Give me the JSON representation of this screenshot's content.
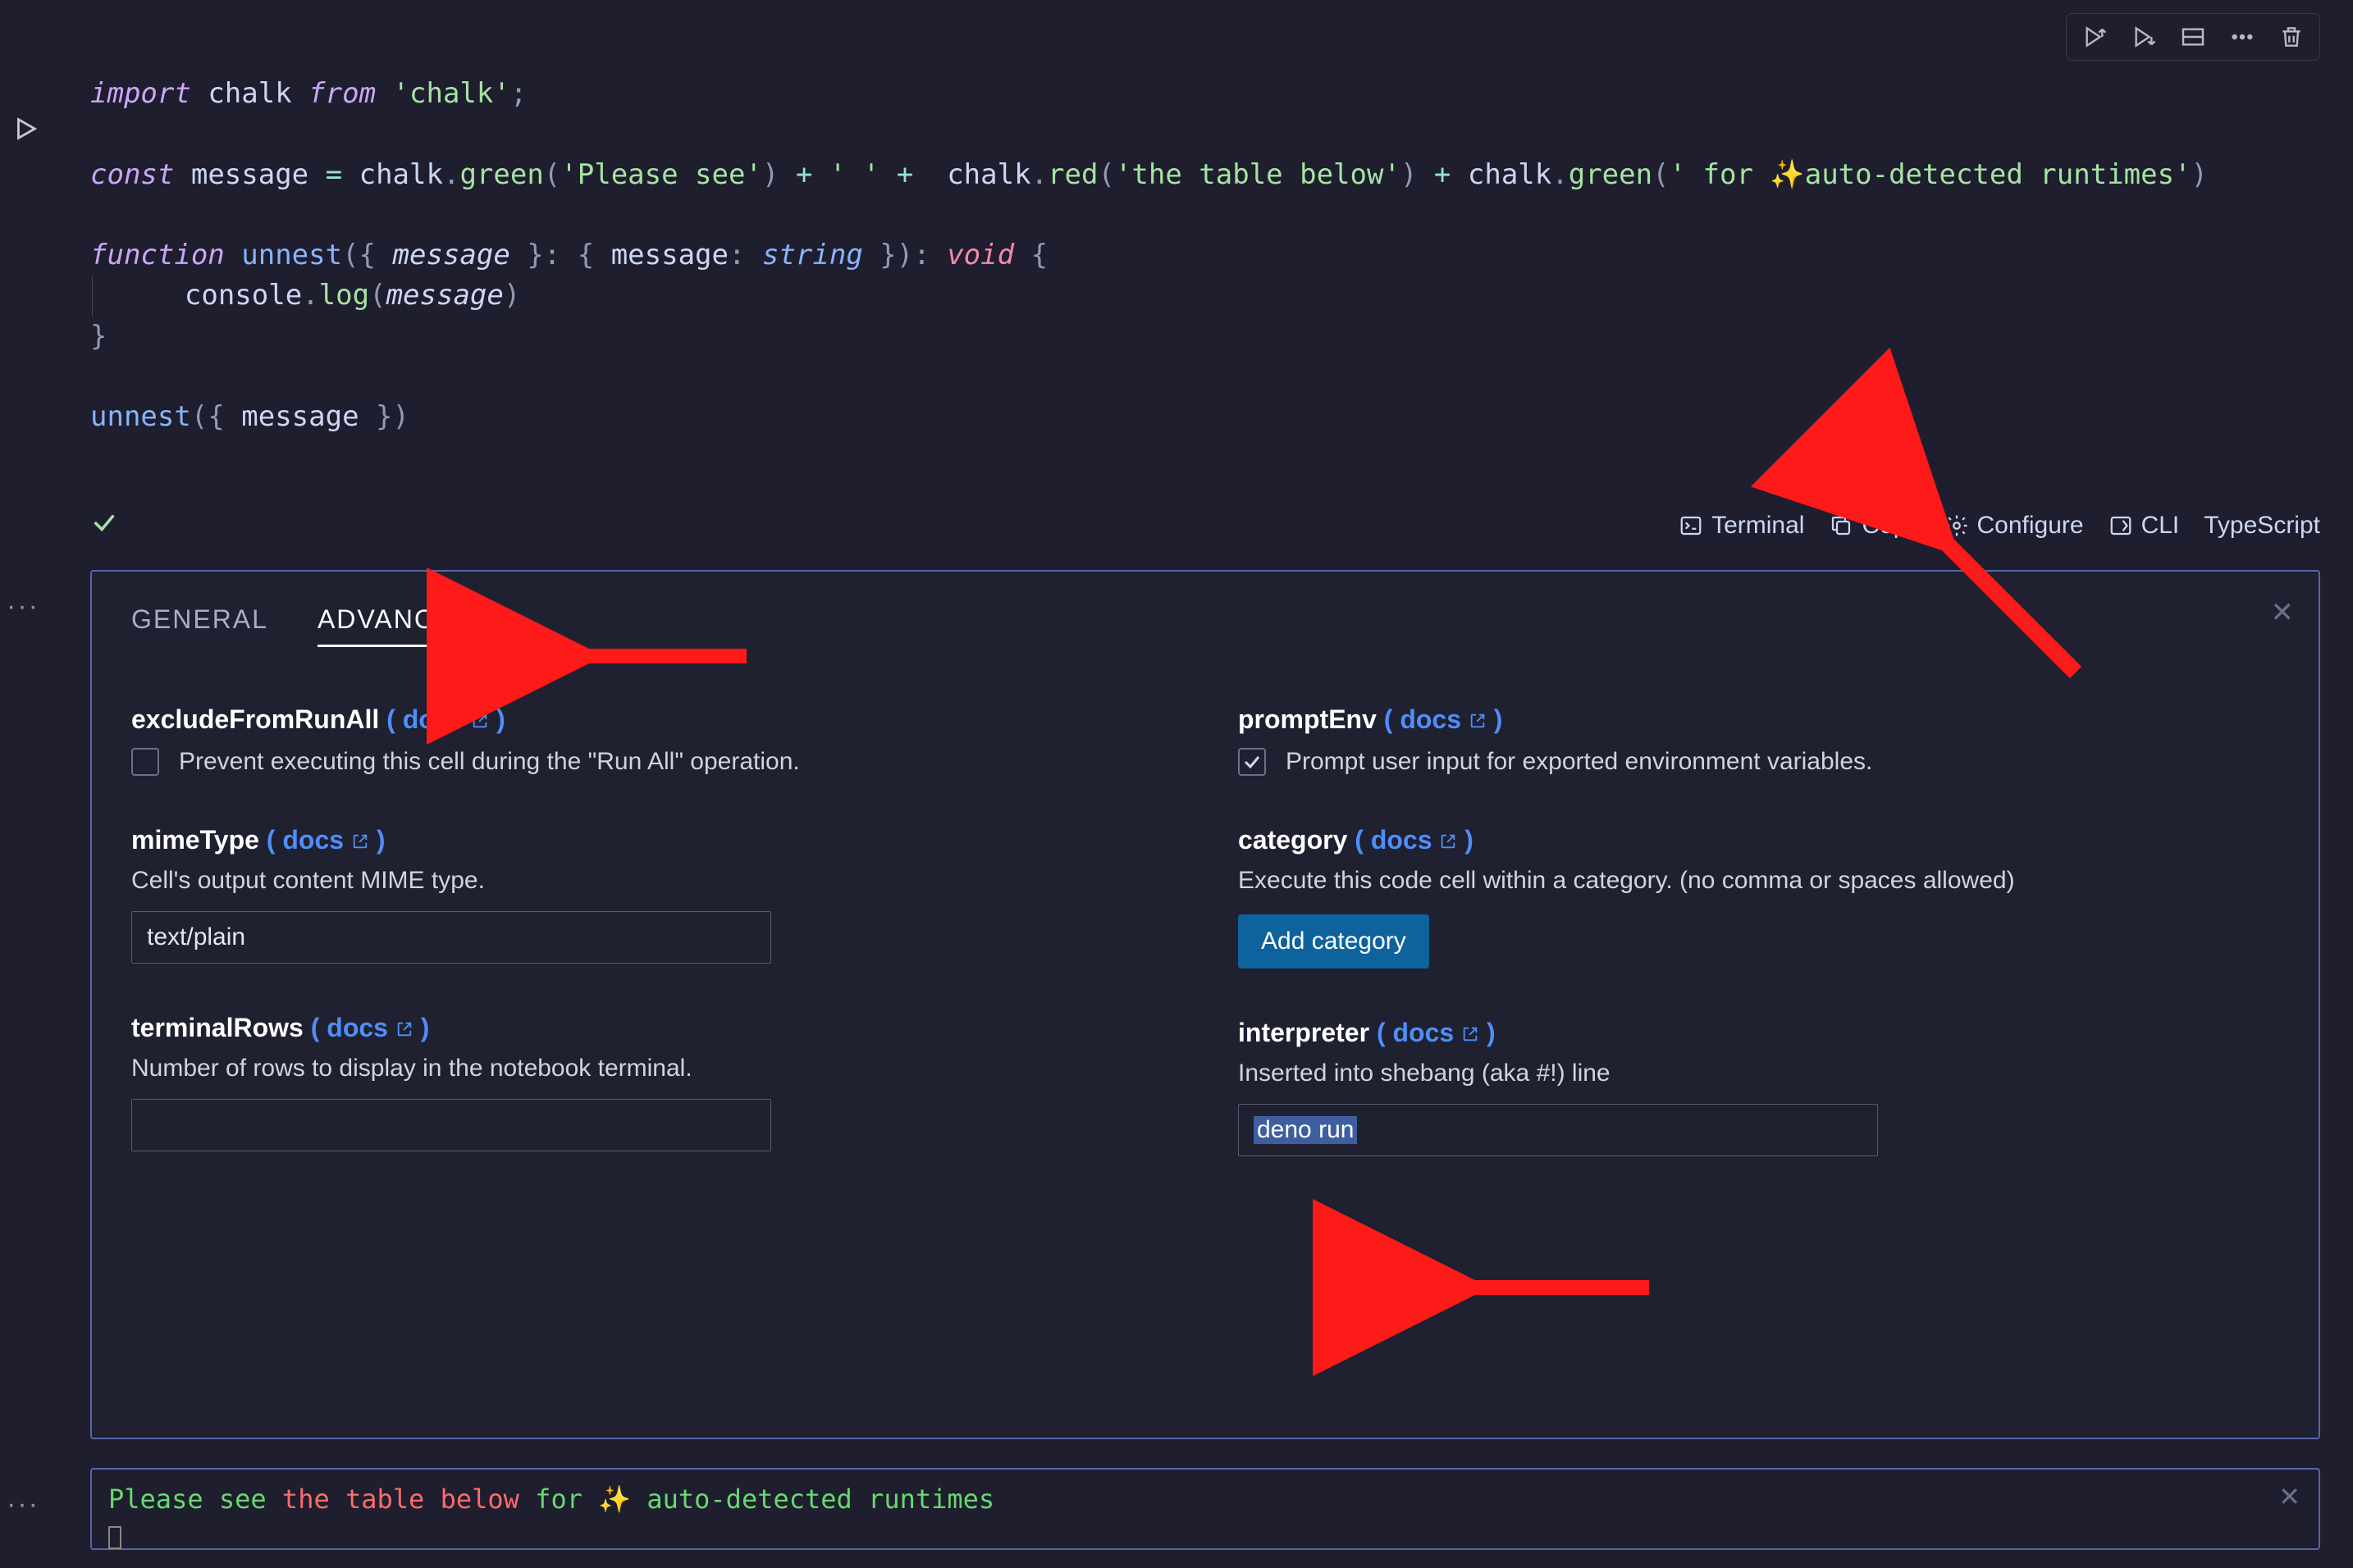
{
  "toolbar": {
    "items": [
      "execute-above",
      "execute-below",
      "split",
      "more",
      "delete"
    ]
  },
  "code": {
    "tokens": "import chalk from 'chalk';\n\nconst message = chalk.green('Please see') + ' ' +  chalk.red('the table below') + chalk.green(' for ✨auto-detected runtimes')\n\nfunction unnest({ message }: { message: string }): void {\n    console.log(message)\n}\n\nunnest({ message })"
  },
  "status": {
    "terminal": "Terminal",
    "copy": "Copy",
    "configure": "Configure",
    "cli": "CLI",
    "language": "TypeScript"
  },
  "config": {
    "tabs": {
      "general": "GENERAL",
      "advanced": "ADVANCED"
    },
    "docs_label": "docs",
    "left": {
      "excludeFromRunAll": {
        "title": "excludeFromRunAll",
        "desc": "Prevent executing this cell during the \"Run All\" operation.",
        "checked": false
      },
      "mimeType": {
        "title": "mimeType",
        "desc": "Cell's output content MIME type.",
        "value": "text/plain"
      },
      "terminalRows": {
        "title": "terminalRows",
        "desc": "Number of rows to display in the notebook terminal.",
        "value": ""
      }
    },
    "right": {
      "promptEnv": {
        "title": "promptEnv",
        "desc": "Prompt user input for exported environment variables.",
        "checked": true
      },
      "category": {
        "title": "category",
        "desc": "Execute this code cell within a category. (no comma or spaces allowed)",
        "button": "Add category"
      },
      "interpreter": {
        "title": "interpreter",
        "desc": "Inserted into shebang (aka #!) line",
        "value": "deno run"
      }
    }
  },
  "output": {
    "seg1": "Please see ",
    "seg2": "the table below",
    "seg3": " for ",
    "seg4": "✨ auto-detected runtimes"
  }
}
